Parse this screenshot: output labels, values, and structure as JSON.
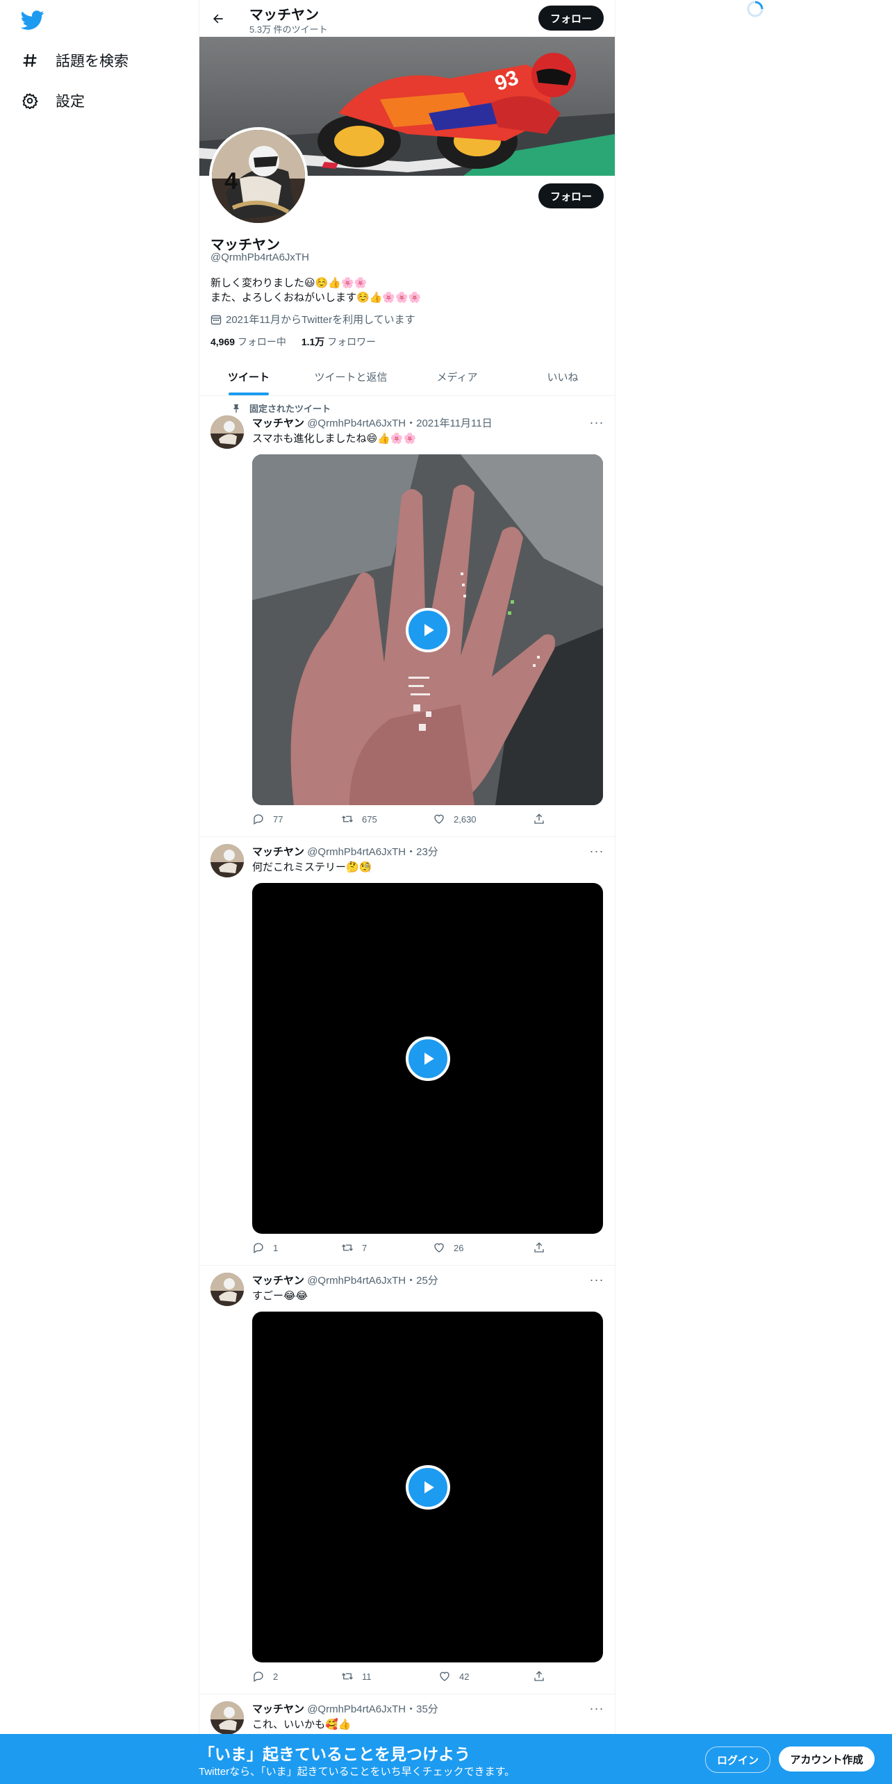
{
  "nav": {
    "explore_label": "話題を検索",
    "settings_label": "設定",
    "icons": [
      "twitter-logo",
      "hashtag-icon",
      "gear-icon"
    ]
  },
  "header": {
    "name": "マッチヤン",
    "tweet_count": "5.3万 件のツイート",
    "follow_label": "フォロー"
  },
  "profile": {
    "name": "マッチヤン",
    "handle": "@QrmhPb4rtA6JxTH",
    "bio_line1": "新しく変わりました😃☺️👍🌸🌸",
    "bio_line2": "また、よろしくおねがいします☺️👍🌸🌸🌸",
    "joined": "2021年11月からTwitterを利用しています",
    "following_count": "4,969",
    "following_label": "フォロー中",
    "followers_count": "1.1万",
    "followers_label": "フォロワー",
    "follow_label": "フォロー"
  },
  "tabs": [
    "ツイート",
    "ツイートと返信",
    "メディア",
    "いいね"
  ],
  "pinned_label": "固定されたツイート",
  "tweets": [
    {
      "name": "マッチヤン",
      "handle_time": "@QrmhPb4rtA6JxTH・2021年11月11日",
      "text": "スマホも進化しましたね😄👍🌸🌸",
      "replies": "77",
      "retweets": "675",
      "likes": "2,630"
    },
    {
      "name": "マッチヤン",
      "handle_time": "@QrmhPb4rtA6JxTH・23分",
      "text": "何だこれミステリー🤔🧐",
      "replies": "1",
      "retweets": "7",
      "likes": "26"
    },
    {
      "name": "マッチヤン",
      "handle_time": "@QrmhPb4rtA6JxTH・25分",
      "text": "すごー😂😂",
      "replies": "2",
      "retweets": "11",
      "likes": "42"
    },
    {
      "name": "マッチヤン",
      "handle_time": "@QrmhPb4rtA6JxTH・35分",
      "text": "これ、いいかも🥰👍"
    }
  ],
  "bottom_bar": {
    "title": "「いま」起きていることを見つけよう",
    "subtitle": "Twitterなら、「いま」起きていることをいち早くチェックできます。",
    "login_label": "ログイン",
    "signup_label": "アカウント作成"
  },
  "colors": {
    "accent": "#1d9bf0",
    "text": "#0f1419",
    "muted": "#536471"
  }
}
